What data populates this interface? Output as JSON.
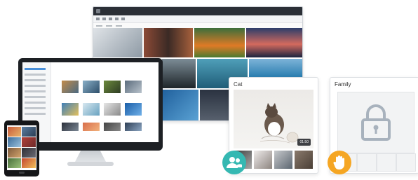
{
  "cat_card": {
    "title": "Cat",
    "duration": "01:50"
  },
  "family_card": {
    "title": "Family"
  },
  "icons": {
    "people": "people-group-icon",
    "hand": "hand-stop-icon",
    "lock": "lock-icon"
  },
  "colors": {
    "teal": "#35b8b2",
    "orange": "#f5a623",
    "window_bar": "#2b2f36",
    "selection": "#4a90d9"
  }
}
